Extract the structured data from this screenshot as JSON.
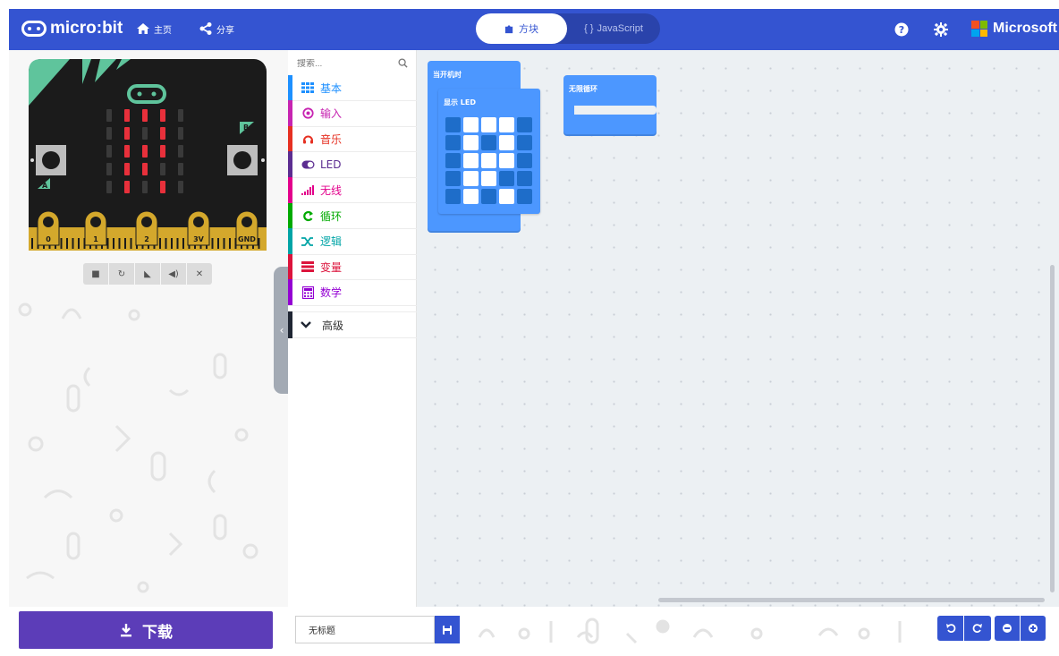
{
  "header": {
    "logo_text": "micro:bit",
    "home_label": "主页",
    "share_label": "分享",
    "toggle_blocks": "方块",
    "toggle_js": "JavaScript",
    "ms_text": "Microsoft"
  },
  "simulator": {
    "pins": [
      "0",
      "1",
      "2",
      "3V",
      "GND"
    ],
    "button_a": "A",
    "button_b": "B",
    "led_pattern": [
      [
        0,
        1,
        1,
        1,
        0
      ],
      [
        0,
        1,
        0,
        1,
        0
      ],
      [
        0,
        1,
        1,
        1,
        0
      ],
      [
        0,
        1,
        1,
        0,
        0
      ],
      [
        0,
        1,
        0,
        1,
        0
      ]
    ]
  },
  "toolbox": {
    "search_placeholder": "搜索...",
    "categories": [
      {
        "label": "基本",
        "color": "#1E90FF"
      },
      {
        "label": "输入",
        "color": "#C724B1"
      },
      {
        "label": "音乐",
        "color": "#E63022"
      },
      {
        "label": "LED",
        "color": "#5C2D91"
      },
      {
        "label": "无线",
        "color": "#E3008C"
      },
      {
        "label": "循环",
        "color": "#00AA00"
      },
      {
        "label": "逻辑",
        "color": "#00A4A6"
      },
      {
        "label": "变量",
        "color": "#DC143C"
      },
      {
        "label": "数学",
        "color": "#9400D3"
      }
    ],
    "advanced_label": "高级"
  },
  "workspace": {
    "on_start_label": "当开机时",
    "show_leds_label": "显示 LED",
    "forever_label": "无限循环",
    "led_grid": [
      [
        0,
        1,
        1,
        1,
        0
      ],
      [
        0,
        1,
        0,
        1,
        0
      ],
      [
        0,
        1,
        1,
        1,
        0
      ],
      [
        0,
        1,
        1,
        0,
        0
      ],
      [
        0,
        1,
        0,
        1,
        0
      ]
    ]
  },
  "footer": {
    "download_label": "下载",
    "project_name": "无标题"
  },
  "colors": {
    "header": "#3454D1",
    "download": "#5C3DB8",
    "block": "#4C97FF",
    "board": "#1B1B1B",
    "led_on": "#E8303B"
  }
}
